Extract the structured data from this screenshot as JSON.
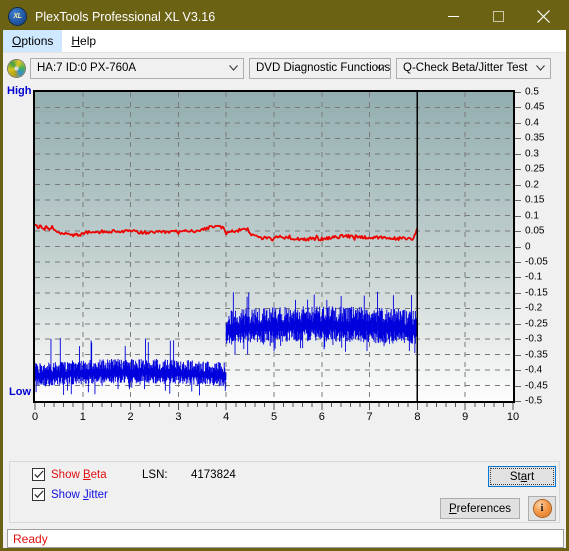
{
  "window": {
    "title": "PlexTools Professional XL V3.16",
    "icon": "XL",
    "minimize_label": "minimize",
    "maximize_label": "maximize",
    "close_label": "close"
  },
  "menubar": {
    "items": [
      {
        "label": "Options",
        "accel": "O",
        "active": true
      },
      {
        "label": "Help",
        "accel": "H",
        "active": false
      }
    ]
  },
  "toolbar": {
    "drive_icon": "disc-icon",
    "drive": {
      "value": "HA:7 ID:0  PX-760A"
    },
    "function": {
      "value": "DVD Diagnostic Functions"
    },
    "test": {
      "value": "Q-Check Beta/Jitter Test"
    }
  },
  "chart_panel": {
    "high_label": "High",
    "low_label": "Low"
  },
  "controls": {
    "show_beta": {
      "label_pre": "Show ",
      "label_accel": "B",
      "label_post": "eta",
      "checked": true
    },
    "show_jitter": {
      "label_pre": "Show ",
      "label_accel": "J",
      "label_post": "itter",
      "checked": true
    },
    "lsn_label": "LSN:",
    "lsn_value": "4173824",
    "start": {
      "pre": "St",
      "accel": "a",
      "post": "rt"
    },
    "preferences": {
      "pre": "",
      "accel": "P",
      "post": "references"
    },
    "info": "i"
  },
  "statusbar": {
    "text": "Ready",
    "color": "#e01010"
  },
  "colors": {
    "titlebar": "#6b6214",
    "beta_series": "#ee0000",
    "jitter_series": "#0000dd",
    "plot_top": "#93aeb0",
    "plot_bottom": "#fdfdfd",
    "grid": "#7a7a7a",
    "axis_label": "#0000d0",
    "menu_highlight": "#cde8ff"
  },
  "chart_data": {
    "type": "line",
    "title": "Q-Check Beta/Jitter Test",
    "xlabel": "",
    "ylabel": "",
    "xlim": [
      0,
      10
    ],
    "ylim": [
      -0.5,
      0.5
    ],
    "grid": true,
    "legend_position": "bottom-left",
    "x_ticks": [
      0,
      1,
      2,
      3,
      4,
      5,
      6,
      7,
      8,
      9,
      10
    ],
    "x_minor_tick_step": 0.2,
    "y_ticks": [
      0.5,
      0.45,
      0.4,
      0.35,
      0.3,
      0.25,
      0.2,
      0.15,
      0.1,
      0.05,
      0,
      -0.05,
      -0.1,
      -0.15,
      -0.2,
      -0.25,
      -0.3,
      -0.35,
      -0.4,
      -0.45,
      -0.5
    ],
    "y_tick_labels": [
      "0.5",
      "0.45",
      "0.4",
      "0.35",
      "0.3",
      "0.25",
      "0.2",
      "0.15",
      "0.1",
      "0.05",
      "0",
      "-0.05",
      "-0.1",
      "-0.15",
      "-0.2",
      "-0.25",
      "-0.3",
      "-0.35",
      "-0.4",
      "-0.45",
      "-0.5"
    ],
    "y_axis_side": "right",
    "data_end_marker_x": 8,
    "series": [
      {
        "name": "Beta",
        "color": "#ee0000",
        "type": "line",
        "x": [
          0.0,
          0.06,
          0.12,
          0.18,
          0.24,
          0.3,
          0.36,
          0.42,
          0.48,
          0.56,
          0.64,
          0.72,
          0.8,
          0.9,
          1.0,
          1.1,
          1.2,
          1.3,
          1.4,
          1.5,
          1.6,
          1.7,
          1.8,
          1.9,
          2.0,
          2.1,
          2.2,
          2.3,
          2.4,
          2.5,
          2.6,
          2.7,
          2.8,
          2.9,
          3.0,
          3.1,
          3.2,
          3.3,
          3.4,
          3.5,
          3.6,
          3.7,
          3.8,
          3.9,
          3.95,
          4.0,
          4.05,
          4.15,
          4.25,
          4.35,
          4.45,
          4.5,
          4.55,
          4.65,
          4.75,
          4.85,
          4.95,
          5.05,
          5.15,
          5.25,
          5.35,
          5.45,
          5.55,
          5.7,
          5.85,
          6.0,
          6.15,
          6.3,
          6.45,
          6.6,
          6.75,
          6.9,
          7.05,
          7.2,
          7.35,
          7.5,
          7.65,
          7.8,
          7.92,
          7.97,
          8.0
        ],
        "y": [
          0.072,
          0.06,
          0.066,
          0.056,
          0.062,
          0.054,
          0.062,
          0.05,
          0.046,
          0.044,
          0.042,
          0.04,
          0.038,
          0.037,
          0.04,
          0.046,
          0.044,
          0.046,
          0.048,
          0.047,
          0.049,
          0.048,
          0.05,
          0.048,
          0.05,
          0.048,
          0.046,
          0.045,
          0.044,
          0.044,
          0.046,
          0.046,
          0.047,
          0.048,
          0.048,
          0.049,
          0.049,
          0.05,
          0.052,
          0.056,
          0.06,
          0.062,
          0.063,
          0.063,
          0.062,
          0.034,
          0.048,
          0.05,
          0.052,
          0.056,
          0.058,
          0.038,
          0.04,
          0.036,
          0.026,
          0.03,
          0.022,
          0.03,
          0.032,
          0.03,
          0.028,
          0.026,
          0.025,
          0.024,
          0.024,
          0.025,
          0.026,
          0.03,
          0.034,
          0.033,
          0.032,
          0.03,
          0.029,
          0.028,
          0.027,
          0.026,
          0.026,
          0.025,
          0.026,
          0.05,
          0.06
        ],
        "note": "Noisy red trace oscillating mostly between 0.02 and 0.07, drop near x=4, rise at x=8"
      },
      {
        "name": "Jitter",
        "color": "#0000dd",
        "type": "band",
        "segments": [
          {
            "x_start": 0.0,
            "x_end": 4.0,
            "y_center": -0.415,
            "y_top": -0.375,
            "y_bottom": -0.455,
            "spike_top": -0.325
          },
          {
            "x_start": 4.0,
            "x_end": 8.0,
            "y_center": -0.265,
            "y_top": -0.205,
            "y_bottom": -0.32,
            "spike_top": -0.175
          }
        ],
        "note": "Dense blue noise band; ~-0.42 for first 4 units then jumps up to ~-0.26"
      }
    ]
  }
}
